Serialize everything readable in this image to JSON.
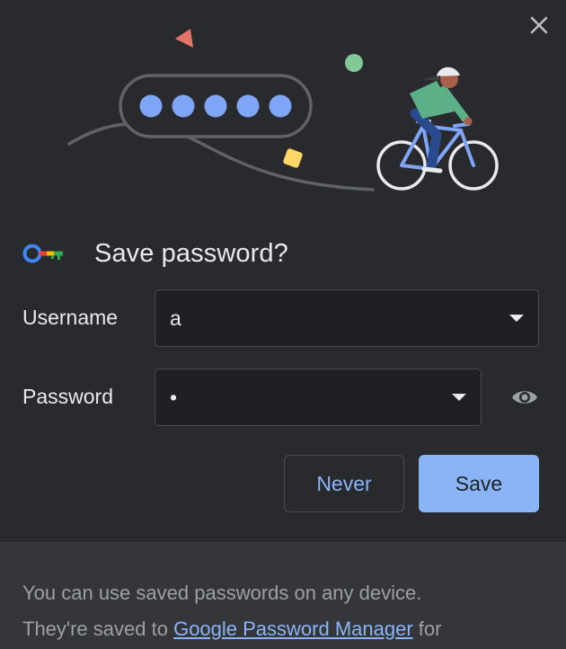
{
  "dialog": {
    "close_label": "×",
    "title": "Save password?"
  },
  "illustration": {
    "masked_dots": "•••••"
  },
  "username": {
    "label": "Username",
    "value": "a"
  },
  "password": {
    "label": "Password",
    "value": "•"
  },
  "buttons": {
    "never_label": "Never",
    "save_label": "Save"
  },
  "footer": {
    "line1": "You can use saved passwords on any device.",
    "line2_prefix": "They're saved to",
    "link_text": "Google Password Manager",
    "line2_suffix": "for"
  },
  "colors": {
    "background": "#292a2d",
    "accent": "#8ab4f8",
    "text_primary": "#e8eaed",
    "text_secondary": "#9aa0a6"
  },
  "icons": {
    "close": "close-icon",
    "key": "key-icon",
    "eye": "eye-icon",
    "dropdown": "chevron-down-icon"
  }
}
